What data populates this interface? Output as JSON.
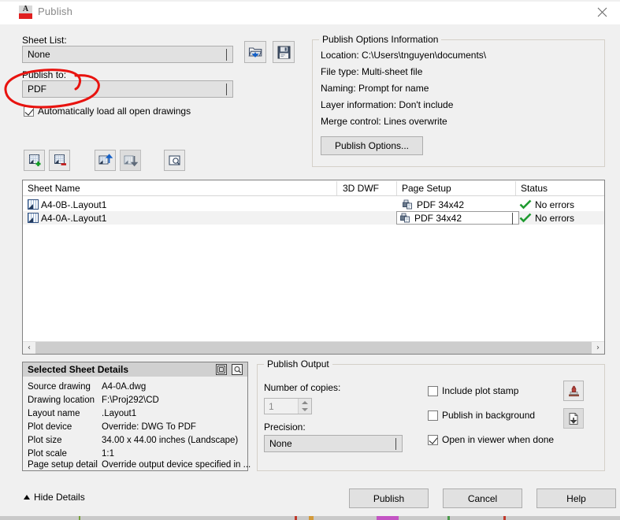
{
  "window": {
    "title": "Publish",
    "logo_letter": "A",
    "close_label": "Close"
  },
  "left_panel": {
    "sheet_list_label": "Sheet List:",
    "sheet_list_value": "None",
    "publish_to_label": "Publish to:",
    "publish_to_value": "PDF",
    "auto_load_label": "Automatically load all open drawings",
    "auto_load_checked": true,
    "load_sheet_list_title": "Load sheet list",
    "save_sheet_list_title": "Save sheet list"
  },
  "toolbar": {
    "buttons": [
      {
        "name": "add-sheets",
        "title": "Add Sheets"
      },
      {
        "name": "remove-sheets",
        "title": "Remove Sheets"
      },
      {
        "name": "move-sheet-up",
        "title": "Move Sheet Up"
      },
      {
        "name": "move-sheet-down",
        "title": "Move Sheet Down"
      },
      {
        "name": "preview-sheet",
        "title": "Preview"
      }
    ]
  },
  "publish_options_info": {
    "legend": "Publish Options Information",
    "lines": [
      "Location:  C:\\Users\\tnguyen\\documents\\",
      "File type: Multi-sheet file",
      "Naming: Prompt for name",
      "Layer information: Don't include",
      "Merge control: Lines overwrite"
    ],
    "button_label": "Publish Options..."
  },
  "sheet_table": {
    "columns": [
      "Sheet Name",
      "3D DWF",
      "Page Setup",
      "Status"
    ],
    "rows": [
      {
        "sheet_name": "A4-0B-.Layout1",
        "dwf3d": "",
        "page_setup": "PDF 34x42",
        "status": "No errors",
        "selected": false
      },
      {
        "sheet_name": "A4-0A-.Layout1",
        "dwf3d": "",
        "page_setup": "PDF 34x42",
        "status": "No errors",
        "selected": true
      }
    ],
    "scroll_left_label": "‹",
    "scroll_right_label": "›"
  },
  "selected_sheet_details": {
    "title": "Selected Sheet Details",
    "rows": [
      {
        "label": "Source drawing",
        "value": "A4-0A.dwg"
      },
      {
        "label": "Drawing location",
        "value": "F:\\Proj292\\CD"
      },
      {
        "label": "Layout name",
        "value": ".Layout1"
      },
      {
        "label": "Plot device",
        "value": "Override: DWG To PDF"
      },
      {
        "label": "Plot size",
        "value": "34.00 x 44.00 inches (Landscape)"
      },
      {
        "label": "Plot scale",
        "value": "1:1"
      },
      {
        "label": "Page setup detail",
        "value": "Override output device specified in ..."
      }
    ],
    "icon_copies_title": "Copy",
    "icon_preview_title": "Preview"
  },
  "publish_output": {
    "legend": "Publish Output",
    "copies_label": "Number of copies:",
    "copies_value": "1",
    "precision_label": "Precision:",
    "precision_value": "None",
    "include_plot_stamp": {
      "label": "Include plot stamp",
      "checked": false
    },
    "publish_in_background": {
      "label": "Publish in background",
      "checked": false
    },
    "open_in_viewer": {
      "label": "Open in viewer when done",
      "checked": true
    },
    "plot_stamp_settings_title": "Plot Stamp Settings",
    "publish_job_title": "Publish Job"
  },
  "footer": {
    "hide_details_label": "Hide Details",
    "publish_label": "Publish",
    "cancel_label": "Cancel",
    "help_label": "Help"
  },
  "annotation": {
    "shape": "red-ellipse",
    "color": "#e8130f",
    "target": "publish-to-combobox"
  },
  "colors": {
    "dialog_bg": "#f0f0f0",
    "control_bg": "#e1e1e1",
    "border": "#adadad",
    "accent_red": "#e02020",
    "status_green": "#1f9b30",
    "annotation_red": "#e8130f"
  }
}
